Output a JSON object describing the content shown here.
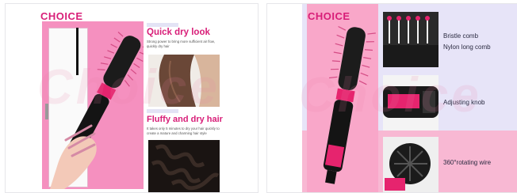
{
  "left_panel": {
    "brand": "CHOICE",
    "section1": {
      "title": "Quick dry look",
      "body": "Strong power to bring more sufficient air flow, quickly dry hair"
    },
    "section2": {
      "title": "Fluffy and dry hair",
      "body": "It takes only 5 minutes to dry your hair quickly to create a mature and charming hair style"
    }
  },
  "right_panel": {
    "brand": "CHOICE",
    "features": [
      {
        "label_line1": "Bristle comb",
        "label_line2": "Nylon long comb"
      },
      {
        "label_line1": "Adjusting knob"
      },
      {
        "label_line1": "360°rotating wire"
      }
    ]
  },
  "colors": {
    "brand_pink": "#d81e78",
    "panel_pink": "#f590bf",
    "lavender": "#e7e4f8"
  }
}
